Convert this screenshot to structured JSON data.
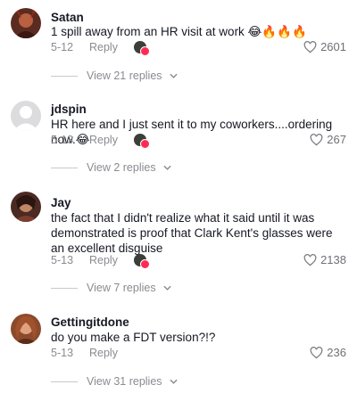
{
  "comments": [
    {
      "username": "Satan",
      "text": "1 spill away from an HR visit at work 😂🔥🔥🔥",
      "date": "5-12",
      "reply_label": "Reply",
      "likes": "2601",
      "view_replies": "View 21 replies",
      "avatar_color": "#5a2b20"
    },
    {
      "username": "jdspin",
      "text": "HR here and I just sent it to my coworkers....ordering now.😂",
      "date": "5-13",
      "reply_label": "Reply",
      "likes": "267",
      "view_replies": "View 2 replies",
      "avatar_color": "#d9d9db"
    },
    {
      "username": "Jay",
      "text": "the fact that I didn't realize what it said until it was demonstrated is proof that Clark Kent's glasses were an excellent disguise",
      "date": "5-13",
      "reply_label": "Reply",
      "likes": "2138",
      "view_replies": "View 7 replies",
      "avatar_color": "#6b3a2e"
    },
    {
      "username": "Gettingitdone",
      "text": "do you make a FDT version?!?",
      "date": "5-13",
      "reply_label": "Reply",
      "likes": "236",
      "view_replies": "View 31 replies",
      "avatar_color": "#a0522d"
    }
  ],
  "colors": {
    "creator_heart": "#fe2c55",
    "meta_text": "#8a8b91"
  }
}
